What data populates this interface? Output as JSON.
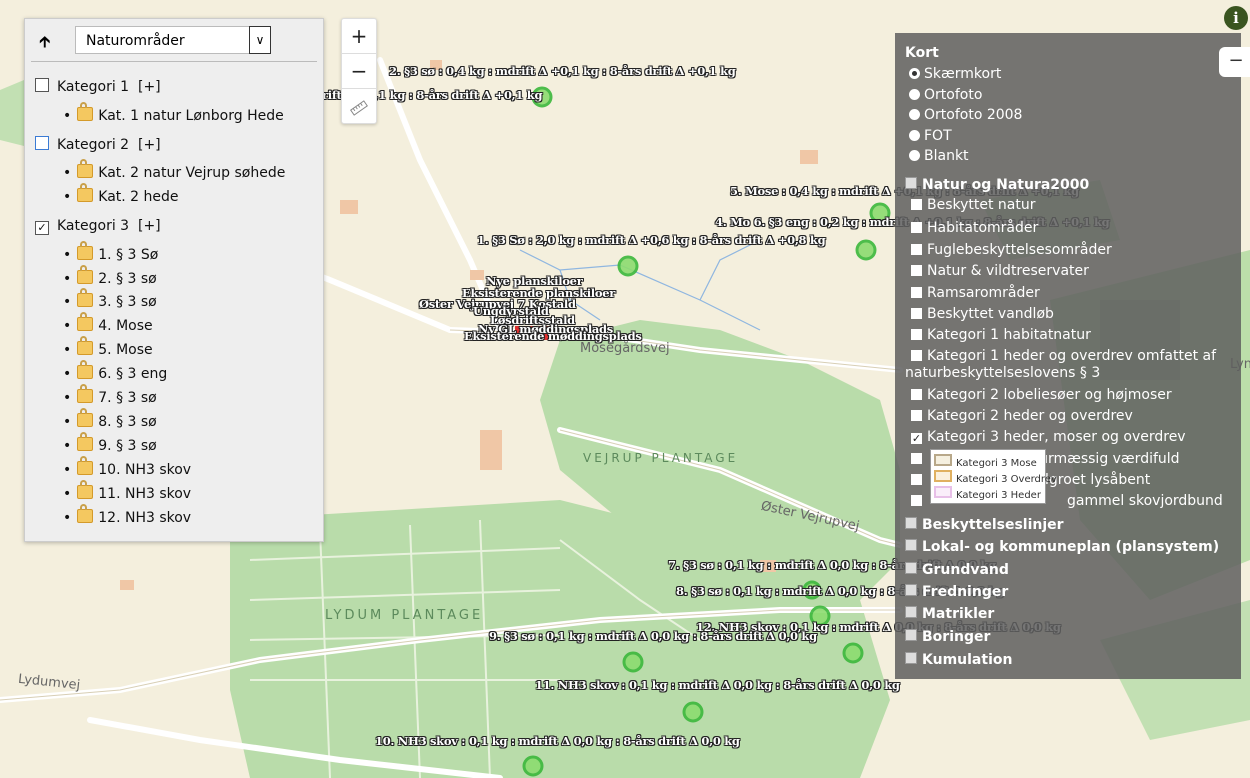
{
  "map": {
    "place_names": [
      "VEJRUP PLANTAGE",
      "LYDUM PLANTAGE"
    ],
    "road_names": [
      "Mosegårdsvej",
      "Øster Vejrupvej",
      "Lydumvej",
      "Lyn"
    ],
    "feature_labels": [
      "2. §3 sø : 0,4 kg : mdrift Δ +0,1 kg : 8-års drift Δ +0,1 kg",
      "rift Δ +0,1 kg : 8-års drift Δ +0,1 kg",
      "5. Mose : 0,4 kg : mdrift Δ +0,1 kg : 8-års drift Δ +0,1 kg",
      "4. Mo 6. §3 eng : 0,2 kg : mdrift Δ +0,1 kg : 8-års drift Δ +0,1 kg",
      "1. §3 Sø : 2,0 kg : mdrift Δ +0,6 kg : 8-års drift Δ +0,8 kg",
      "Nye planskiloer",
      "Eksisterende planskiloer",
      "Øster Vejrupvej 7 Kostald",
      "Ungdyrstald",
      "Løsdriftsstald",
      "Ny GL møddingsplads",
      "Eksisterende møddingsplads",
      "7. §3 sø : 0,1 kg : mdrift Δ 0,0 kg : 8-års drift Δ 0,0 kg",
      "8. §3 sø : 0,1 kg : mdrift Δ 0,0 kg : 8-års drift Δ 0,0 kg",
      "12. NH3 skov : 0,1 kg : mdrift Δ 0,0 kg : 8-års drift Δ 0,0 kg",
      "9. §3 sø : 0,1 kg : mdrift Δ 0,0 kg : 8-års drift Δ 0,0 kg",
      "11. NH3 skov : 0,1 kg : mdrift Δ 0,0 kg : 8-års drift Δ 0,0 kg",
      "10. NH3 skov : 0,1 kg : mdrift Δ 0,0 kg : 8-års drift Δ 0,0 kg"
    ]
  },
  "zoom": {
    "in": "+",
    "out": "−"
  },
  "left_panel": {
    "theme_select": "Naturområder",
    "categories": [
      {
        "label": "Kategori 1",
        "expand": "[+]",
        "checked": false,
        "items": [
          "Kat. 1 natur Lønborg Hede"
        ]
      },
      {
        "label": "Kategori 2",
        "expand": "[+]",
        "checked": false,
        "items": [
          "Kat. 2 natur Vejrup søhede",
          "Kat. 2 hede"
        ]
      },
      {
        "label": "Kategori 3",
        "expand": "[+]",
        "checked": true,
        "items": [
          "1. § 3 Sø",
          "2. § 3 sø",
          "3. § 3 sø",
          "4. Mose",
          "5. Mose",
          "6. § 3 eng",
          "7. § 3 sø",
          "8. § 3 sø",
          "9. § 3 sø",
          "10. NH3 skov",
          "11. NH3 skov",
          "12. NH3 skov"
        ]
      }
    ]
  },
  "right_panel": {
    "title": "Kort",
    "basemaps": [
      "Skærmkort",
      "Ortofoto",
      "Ortofoto 2008",
      "FOT",
      "Blankt"
    ],
    "selected_basemap": "Skærmkort",
    "group_natur": "Natur og Natura2000",
    "natur_layers": [
      "Beskyttet natur",
      "Habitatområder",
      "Fuglebeskyttelsesområder",
      "Natur & vildtreservater",
      "Ramsarområder",
      "Beskyttet vandløb",
      "Kategori 1 habitatnatur",
      "Kategori 1 heder og overdrev omfattet af",
      "naturbeskyttelseslovens § 3",
      "Kategori 2 lobeliesøer og højmoser",
      "Kategori 2 heder og overdrev",
      "Kategori 3 heder, moser og overdrev",
      "aturmæssig værdifuld",
      "lgroet lysåbent",
      "gammel skovjordbund"
    ],
    "checked_layer": "Kategori 3 heder, moser og overdrev",
    "legend": [
      {
        "label": "Kategori 3 Mose",
        "color": "#b8a88a"
      },
      {
        "label": "Kategori 3 Overdrev",
        "color": "#e0b060"
      },
      {
        "label": "Kategori 3 Heder",
        "color": "#e8c0e8"
      }
    ],
    "groups": [
      "Beskyttelseslinjer",
      "Lokal- og kommuneplan (plansystem)",
      "Grundvand",
      "Fredninger",
      "Matrikler",
      "Boringer",
      "Kumulation"
    ]
  },
  "info_icon": "i",
  "collapse_icon": "−",
  "icons": [
    "up-arrow-icon",
    "chevron-down-icon",
    "ruler-icon",
    "lock-icon",
    "info-icon"
  ]
}
